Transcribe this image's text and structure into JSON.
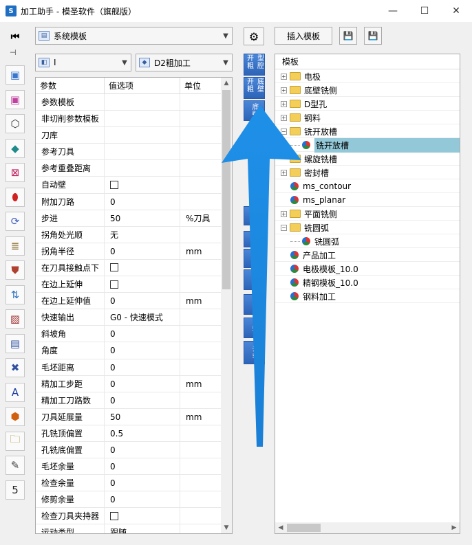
{
  "window": {
    "title": "加工助手 - 模圣软件（旗舰版）",
    "app_icon_text": "S",
    "minimize": "—",
    "maximize": "☐",
    "close": "✕"
  },
  "left_toolbar": {
    "first": "⏮",
    "pin": "⊣",
    "icons": [
      "cube-blue-icon",
      "cube-pink-icon",
      "cube-wire-icon",
      "cube-teal-icon",
      "feature-icon",
      "red-solid-icon",
      "orbit-icon",
      "lines-icon",
      "person-icon",
      "arrow-cube-icon",
      "measure-icon",
      "layers-icon",
      "cross-layers-icon",
      "text-icon",
      "color-cube-icon",
      "folder-icon",
      "pen-icon",
      "number-icon"
    ],
    "glyphs": [
      "▣",
      "▣",
      "⬡",
      "◆",
      "⊠",
      "⬮",
      "⟳",
      "≣",
      "⛊",
      "⇅",
      "▨",
      "▤",
      "✖",
      "A",
      "⬢",
      "🗀",
      "✎",
      "5"
    ]
  },
  "param_panel": {
    "template_combo": "系统模板",
    "tool_combo": "I",
    "mode_combo": "D2粗加工",
    "headers": [
      "参数",
      "值选项",
      "单位"
    ],
    "rows": [
      {
        "name": "参数模板",
        "value": "",
        "unit": "",
        "check": false
      },
      {
        "name": "非切削参数模板",
        "value": "",
        "unit": "",
        "check": false
      },
      {
        "name": "刀库",
        "value": "",
        "unit": "",
        "check": false
      },
      {
        "name": "参考刀具",
        "value": "",
        "unit": "",
        "check": false
      },
      {
        "name": "参考重叠距离",
        "value": "",
        "unit": "",
        "check": false
      },
      {
        "name": "自动壁",
        "value": "",
        "unit": "",
        "check": true
      },
      {
        "name": "附加刀路",
        "value": "0",
        "unit": "",
        "check": false
      },
      {
        "name": "步进",
        "value": "50",
        "unit": "%刀具",
        "check": false
      },
      {
        "name": "拐角处光顺",
        "value": "无",
        "unit": "",
        "check": false
      },
      {
        "name": "拐角半径",
        "value": "0",
        "unit": "mm",
        "check": false
      },
      {
        "name": "在刀具接触点下",
        "value": "",
        "unit": "",
        "check": true
      },
      {
        "name": "在边上延伸",
        "value": "",
        "unit": "",
        "check": true
      },
      {
        "name": "在边上延伸值",
        "value": "0",
        "unit": "mm",
        "check": false
      },
      {
        "name": "快速输出",
        "value": "G0 - 快速模式",
        "unit": "",
        "check": false
      },
      {
        "name": "斜坡角",
        "value": "0",
        "unit": "",
        "check": false
      },
      {
        "name": "角度",
        "value": "0",
        "unit": "",
        "check": false
      },
      {
        "name": "毛坯距离",
        "value": "0",
        "unit": "",
        "check": false
      },
      {
        "name": "精加工步距",
        "value": "0",
        "unit": "mm",
        "check": false
      },
      {
        "name": "精加工刀路数",
        "value": "0",
        "unit": "",
        "check": false
      },
      {
        "name": "刀具延展量",
        "value": "50",
        "unit": "mm",
        "check": false
      },
      {
        "name": "孔铣顶偏置",
        "value": "0.5",
        "unit": "",
        "check": false
      },
      {
        "name": "孔铣底偏置",
        "value": "0",
        "unit": "",
        "check": false
      },
      {
        "name": "毛坯余量",
        "value": "0",
        "unit": "",
        "check": false
      },
      {
        "name": "检查余量",
        "value": "0",
        "unit": "",
        "check": false
      },
      {
        "name": "修剪余量",
        "value": "0",
        "unit": "",
        "check": false
      },
      {
        "name": "检查刀具夹持器",
        "value": "",
        "unit": "",
        "check": true
      },
      {
        "name": "运动类型",
        "value": "跟随",
        "unit": "",
        "check": false
      }
    ]
  },
  "middle": {
    "gear": "⚙",
    "tabs": [
      "型腔开粗",
      "底壁开粗",
      "底壁",
      "",
      "",
      "",
      "上",
      "铣",
      "螺",
      "去毛"
    ]
  },
  "right_panel": {
    "insert_button": "插入模板",
    "save_icon": "💾",
    "saveas_icon": "💾",
    "tree_header": "模板",
    "nodes": [
      {
        "label": "电极",
        "kind": "folder",
        "level": 0,
        "expander": "+"
      },
      {
        "label": "底壁铣侧",
        "kind": "folder",
        "level": 0,
        "expander": "+"
      },
      {
        "label": "D型孔",
        "kind": "folder",
        "level": 0,
        "expander": "+"
      },
      {
        "label": "钢料",
        "kind": "folder",
        "level": 0,
        "expander": "+"
      },
      {
        "label": "铣开放槽",
        "kind": "folder",
        "level": 0,
        "expander": "−"
      },
      {
        "label": "铣开放槽",
        "kind": "op",
        "level": 1,
        "expander": "",
        "selected": true
      },
      {
        "label": "螺旋铣槽",
        "kind": "folder",
        "level": 0,
        "expander": ""
      },
      {
        "label": "密封槽",
        "kind": "folder",
        "level": 0,
        "expander": "+"
      },
      {
        "label": "ms_contour",
        "kind": "op",
        "level": 0,
        "expander": ""
      },
      {
        "label": "ms_planar",
        "kind": "op",
        "level": 0,
        "expander": ""
      },
      {
        "label": "平面铣侧",
        "kind": "folder",
        "level": 0,
        "expander": "+"
      },
      {
        "label": "铣圆弧",
        "kind": "folder",
        "level": 0,
        "expander": "−"
      },
      {
        "label": "铣圆弧",
        "kind": "op",
        "level": 1,
        "expander": ""
      },
      {
        "label": "产品加工",
        "kind": "op",
        "level": 0,
        "expander": ""
      },
      {
        "label": "电极模板_10.0",
        "kind": "op",
        "level": 0,
        "expander": ""
      },
      {
        "label": "精钢模板_10.0",
        "kind": "op",
        "level": 0,
        "expander": ""
      },
      {
        "label": "钢料加工",
        "kind": "op",
        "level": 0,
        "expander": ""
      }
    ]
  },
  "colors": {
    "arrow": "#1e90e8",
    "selection": "#93c8d8",
    "tab_blue": "#3a76cc"
  }
}
